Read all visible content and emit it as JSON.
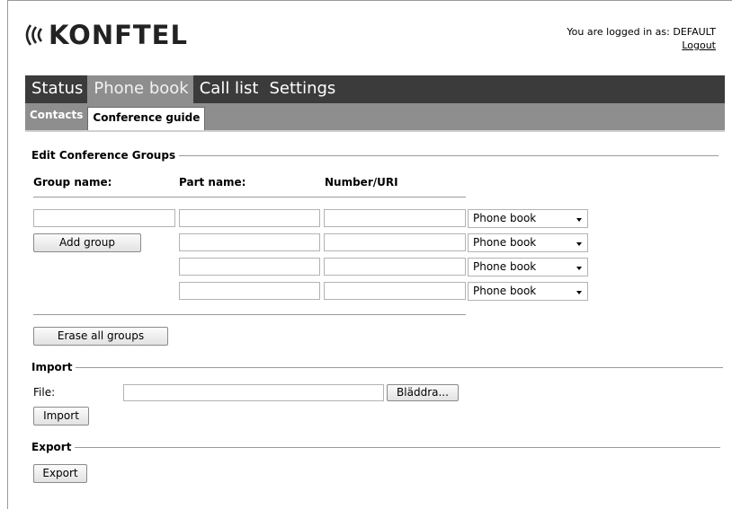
{
  "header": {
    "brand": "KONFTEL",
    "login_text": "You are logged in as: DEFAULT",
    "logout_label": "Logout"
  },
  "nav": {
    "main": [
      {
        "label": "Status",
        "active": false
      },
      {
        "label": "Phone book",
        "active": true
      },
      {
        "label": "Call list",
        "active": false
      },
      {
        "label": "Settings",
        "active": false
      }
    ],
    "sub": [
      {
        "label": "Contacts",
        "active": false
      },
      {
        "label": "Conference guide",
        "active": true
      }
    ]
  },
  "groups": {
    "section_title": "Edit Conference Groups",
    "col_group": "Group name:",
    "col_part": "Part name:",
    "col_number": "Number/URI",
    "add_group_label": "Add group",
    "erase_label": "Erase all groups",
    "rows": [
      {
        "part": "",
        "number": "",
        "source": "Phone book"
      },
      {
        "part": "",
        "number": "",
        "source": "Phone book"
      },
      {
        "part": "",
        "number": "",
        "source": "Phone book"
      },
      {
        "part": "",
        "number": "",
        "source": "Phone book"
      }
    ],
    "group_name_value": ""
  },
  "import": {
    "section_title": "Import",
    "file_label": "File:",
    "browse_label": "Bläddra...",
    "import_label": "Import",
    "file_value": ""
  },
  "export": {
    "section_title": "Export",
    "export_label": "Export"
  }
}
